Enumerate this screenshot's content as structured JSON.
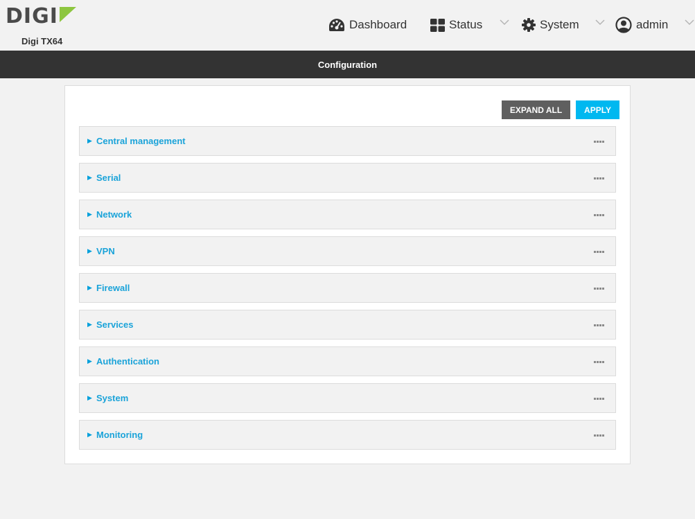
{
  "header": {
    "brand": "DIGI",
    "device_name": "Digi TX64",
    "nav": [
      {
        "label": "Dashboard",
        "icon": "dashboard-icon"
      },
      {
        "label": "Status",
        "icon": "grid-icon"
      },
      {
        "label": "System",
        "icon": "gear-icon"
      },
      {
        "label": "admin",
        "icon": "user-icon"
      }
    ]
  },
  "page": {
    "title": "Configuration"
  },
  "toolbar": {
    "expand_all_label": "EXPAND ALL",
    "apply_label": "APPLY"
  },
  "sections": [
    {
      "label": "Central management"
    },
    {
      "label": "Serial"
    },
    {
      "label": "Network"
    },
    {
      "label": "VPN"
    },
    {
      "label": "Firewall"
    },
    {
      "label": "Services"
    },
    {
      "label": "Authentication"
    },
    {
      "label": "System"
    },
    {
      "label": "Monitoring"
    }
  ],
  "colors": {
    "brand_green": "#8dc63f",
    "accent_blue": "#00b8f0",
    "section_text": "#1aa3d9",
    "titlebar_bg": "#333333"
  }
}
